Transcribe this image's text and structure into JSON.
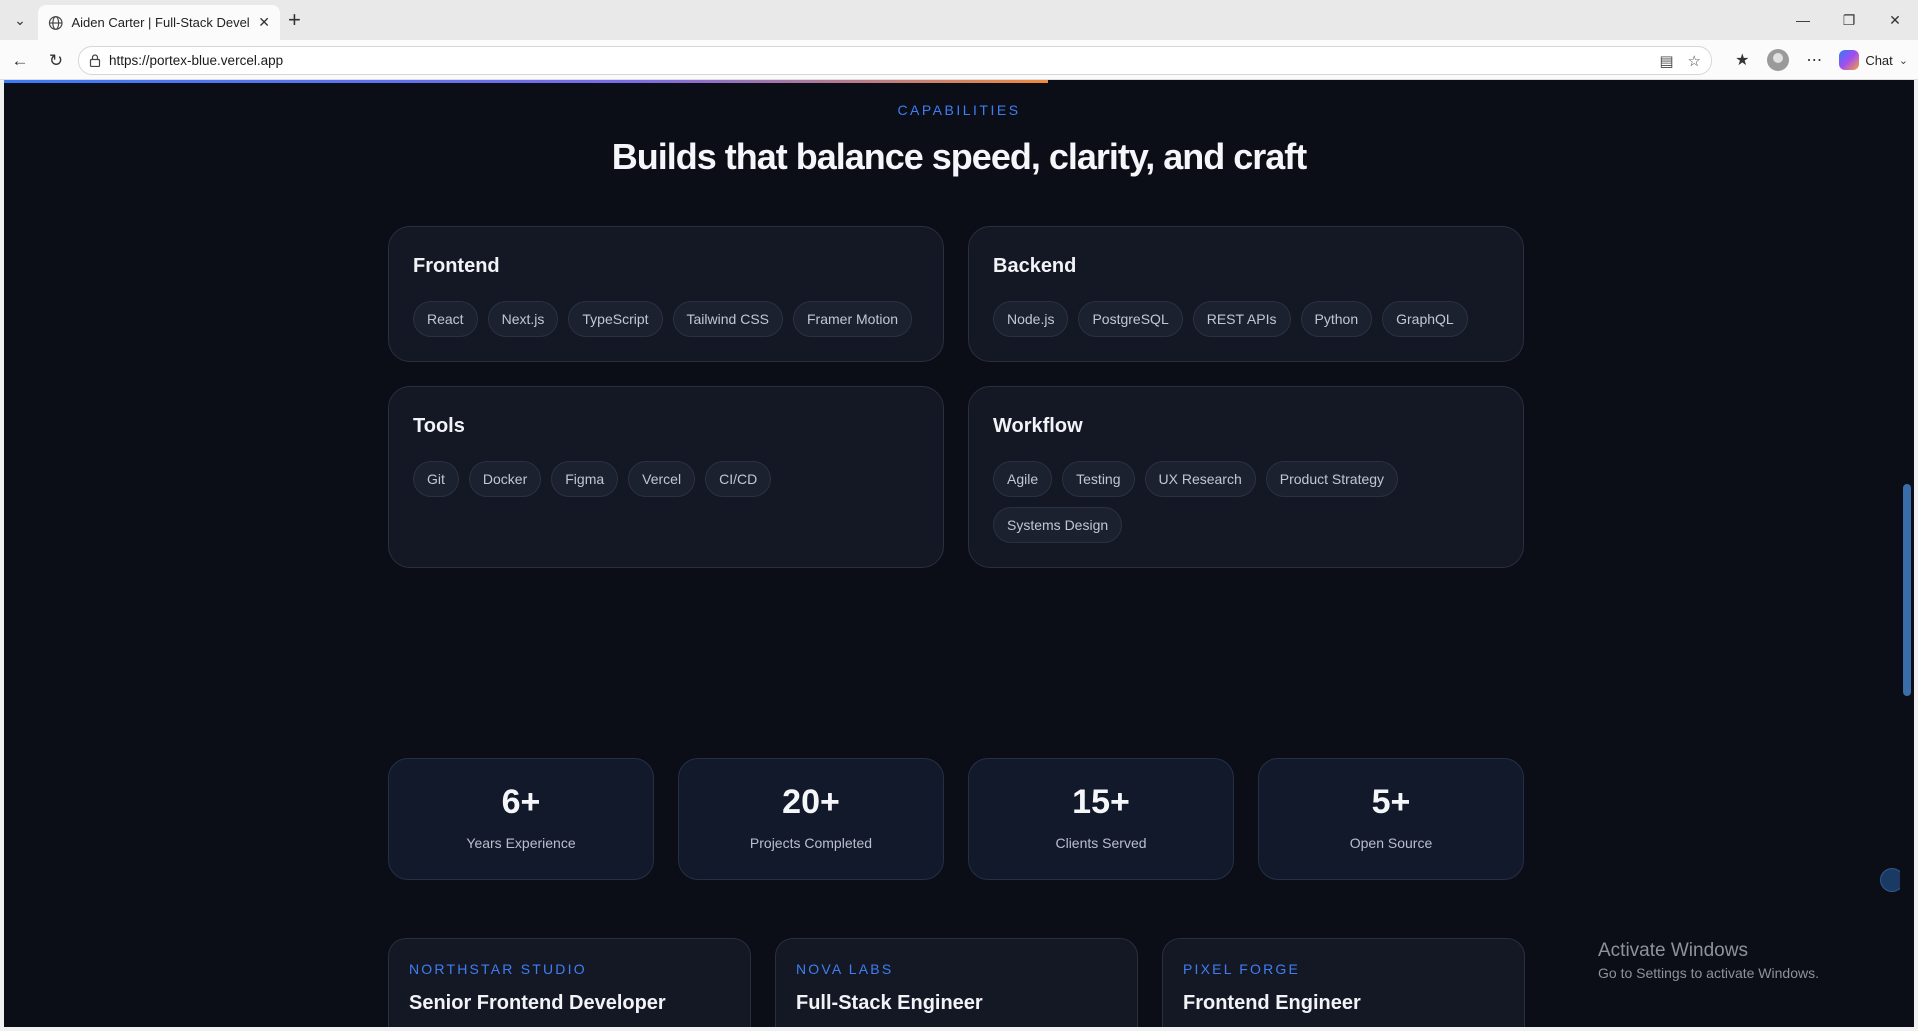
{
  "browser": {
    "tab_title": "Aiden Carter | Full-Stack Developer",
    "url": "https://portex-blue.vercel.app",
    "chat_label": "Chat"
  },
  "capabilities": {
    "eyebrow": "CAPABILITIES",
    "headline": "Builds that balance speed, clarity, and craft",
    "groups": [
      {
        "title": "Frontend",
        "items": [
          "React",
          "Next.js",
          "TypeScript",
          "Tailwind CSS",
          "Framer Motion"
        ]
      },
      {
        "title": "Backend",
        "items": [
          "Node.js",
          "PostgreSQL",
          "REST APIs",
          "Python",
          "GraphQL"
        ]
      },
      {
        "title": "Tools",
        "items": [
          "Git",
          "Docker",
          "Figma",
          "Vercel",
          "CI/CD"
        ]
      },
      {
        "title": "Workflow",
        "items": [
          "Agile",
          "Testing",
          "UX Research",
          "Product Strategy",
          "Systems Design"
        ]
      }
    ]
  },
  "stats": [
    {
      "value": "6+",
      "label": "Years Experience"
    },
    {
      "value": "20+",
      "label": "Projects Completed"
    },
    {
      "value": "15+",
      "label": "Clients Served"
    },
    {
      "value": "5+",
      "label": "Open Source"
    }
  ],
  "experience": [
    {
      "company": "NORTHSTAR STUDIO",
      "role": "Senior Frontend Developer"
    },
    {
      "company": "NOVA LABS",
      "role": "Full-Stack Engineer"
    },
    {
      "company": "PIXEL FORGE",
      "role": "Frontend Engineer"
    }
  ],
  "os_overlay": {
    "title": "Activate Windows",
    "subtitle": "Go to Settings to activate Windows."
  }
}
